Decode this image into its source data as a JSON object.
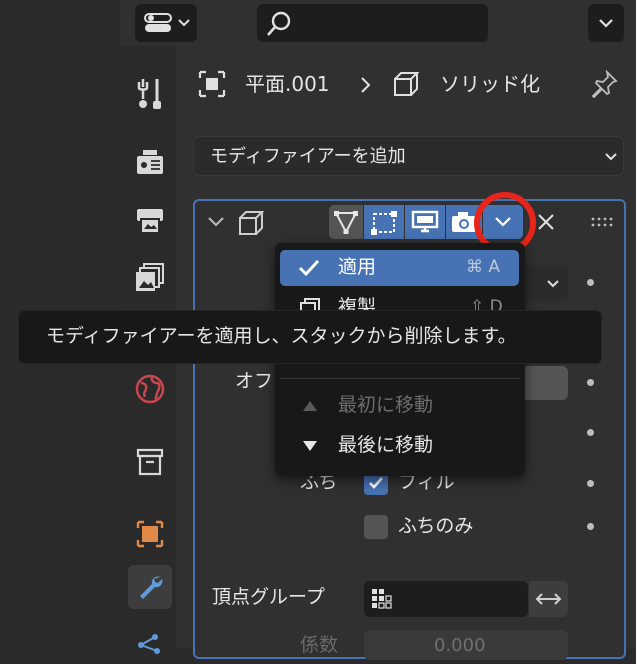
{
  "header": {
    "search_placeholder": ""
  },
  "breadcrumb": {
    "object": "平面.001",
    "modifier": "ソリッド化"
  },
  "add_modifier": {
    "label": "モディファイアーを追加"
  },
  "panel_labels": {
    "offset": "オフ",
    "rim": "ふち",
    "fill": "フィル",
    "rim_only": "ふちのみ",
    "vertex_group": "頂点グループ",
    "factor": "係数",
    "factor_value": "0.000"
  },
  "menu": {
    "apply": {
      "label": "適用",
      "shortcut": "⌘ A"
    },
    "duplicate": {
      "label": "複製",
      "shortcut": "⇧ D"
    },
    "move_first": {
      "label": "最初に移動"
    },
    "move_last": {
      "label": "最後に移動"
    }
  },
  "tooltip": {
    "text": "モディファイアーを適用し、スタックから削除します。"
  },
  "colors": {
    "accent": "#4772b3",
    "highlight_circle": "#e8251a",
    "panel_bg": "#303030",
    "menu_bg": "#181818"
  },
  "icons": [
    "editor-type-icon",
    "search-icon",
    "collapse-icon",
    "tool-icon",
    "render-icon",
    "output-icon",
    "view-layer-icon",
    "world-icon",
    "collection-icon",
    "object-icon",
    "modifier-wrench-icon",
    "particles-icon",
    "plane-icon",
    "solidify-cube-icon",
    "pin-icon",
    "edit-mode-icon",
    "editmode-cage-icon",
    "realtime-monitor-icon",
    "render-camera-icon",
    "dropdown-chevron-icon",
    "close-icon",
    "drag-handle-icon",
    "checkmark-icon",
    "group-icon",
    "swap-arrows-icon"
  ]
}
